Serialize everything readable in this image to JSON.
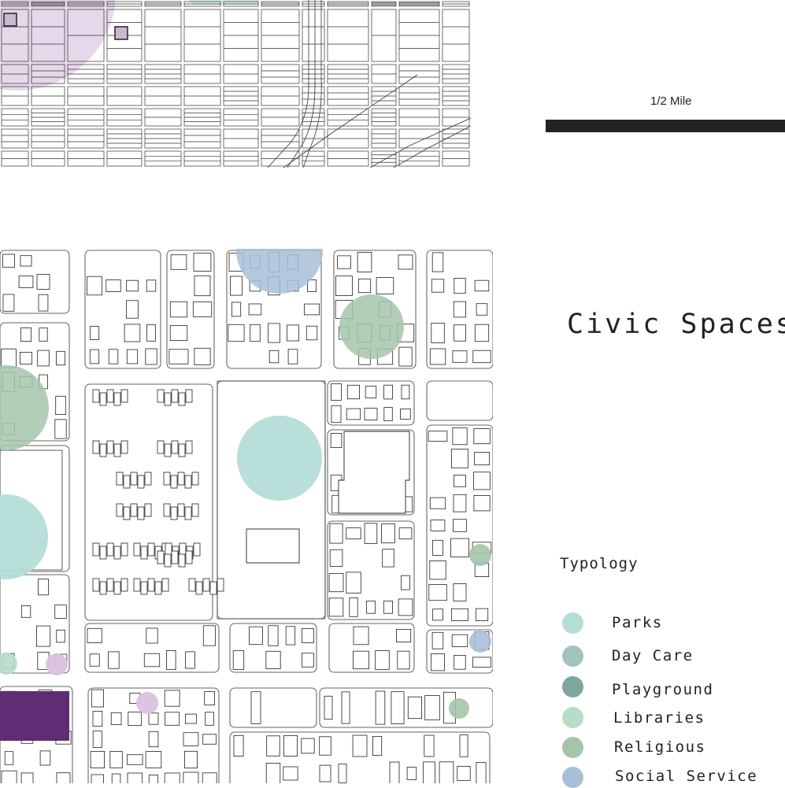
{
  "scale": {
    "label": "1/2 Mile"
  },
  "title": "Civic Spaces",
  "legend": {
    "heading": "Typology",
    "items": [
      {
        "label": "Parks",
        "color": "#b4ddd8",
        "icon": "parks-dot-icon"
      },
      {
        "label": "Day Care",
        "color": "#9fc4c0",
        "icon": "day-care-dot-icon"
      },
      {
        "label": "Playground",
        "color": "#7fa5a1",
        "icon": "playground-dot-icon"
      },
      {
        "label": "Libraries",
        "color": "#b7ddc6",
        "icon": "libraries-dot-icon"
      },
      {
        "label": "Religious",
        "color": "#a4c5aa",
        "icon": "religious-dot-icon"
      },
      {
        "label": "Social Service",
        "color": "#a8bfd8",
        "icon": "social-service-dot-icon"
      }
    ]
  },
  "colors": {
    "community_center": "#5e2d74",
    "lot_purple": "#cbb7d3",
    "buffer_purple": "#e7d7ea",
    "line": "#222222"
  }
}
